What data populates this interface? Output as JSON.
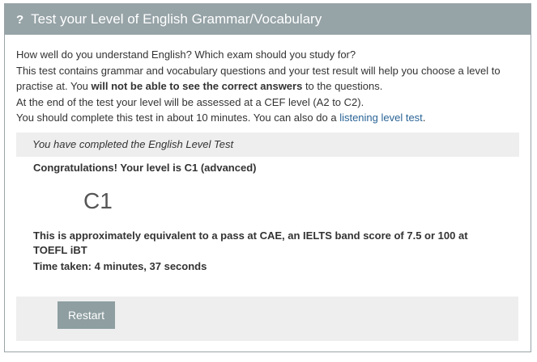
{
  "header": {
    "icon": "question-mark-icon",
    "title": "Test your Level of English Grammar/Vocabulary"
  },
  "intro": {
    "line1": "How well do you understand English? Which exam should you study for?",
    "line2": "This test contains grammar and vocabulary questions and your test result will help you choose a level to practise at. You ",
    "line2_bold": "will not be able to see the correct answers",
    "line2_end": " to the questions.",
    "line3": "At the end of the test your level will be assessed at a CEF level (A2 to C2).",
    "line4": "You should complete this test in about 10 minutes. You can also do a ",
    "link": "listening level test",
    "line4_end": "."
  },
  "result": {
    "status": "You have completed the English Level Test",
    "congrats": "Congratulations! Your level is C1 (advanced)",
    "level_code": "C1",
    "equivalence": "This is approximately equivalent to a pass at CAE, an IELTS band score of 7.5 or 100 at TOEFL iBT",
    "time_taken": "Time taken: 4 minutes, 37 seconds"
  },
  "actions": {
    "restart_label": "Restart"
  },
  "colors": {
    "header_bg": "#96a3a7",
    "bar_bg": "#eeeeee",
    "link": "#2a6496",
    "button_bg": "#8e9ea1"
  }
}
